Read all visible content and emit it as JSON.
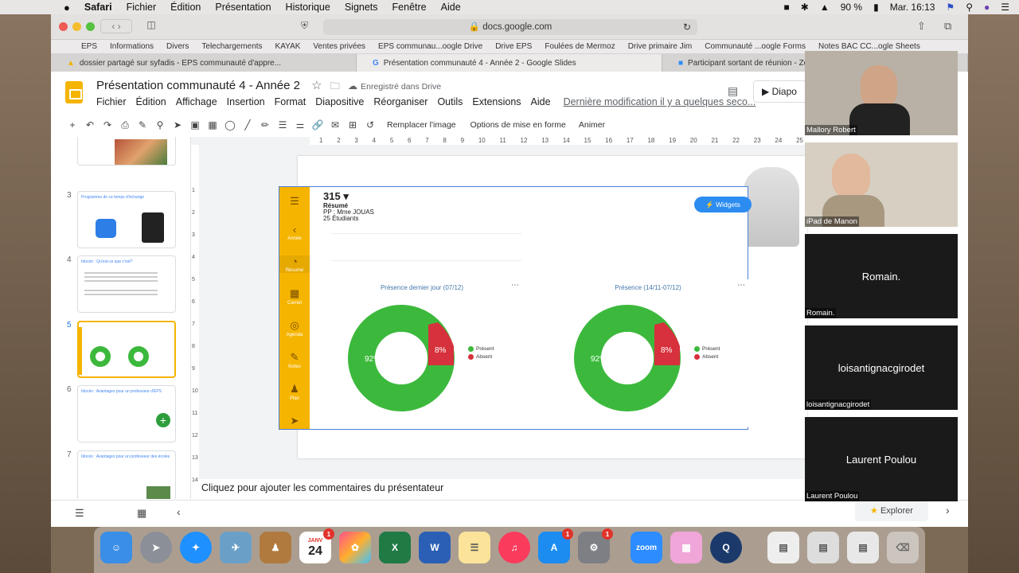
{
  "menubar": {
    "apple": "",
    "items": [
      "Safari",
      "Fichier",
      "Édition",
      "Présentation",
      "Historique",
      "Signets",
      "Fenêtre",
      "Aide"
    ],
    "battery": "90 %",
    "clock": "Mar. 16:13"
  },
  "browser": {
    "url": "docs.google.com",
    "bookmarks": [
      "EPS",
      "Informations",
      "Divers",
      "Telechargements",
      "KAYAK",
      "Ventes privées",
      "EPS communau...oogle Drive",
      "Drive EPS",
      "Foulées de Mermoz",
      "Drive primaire Jim",
      "Communauté ...oogle Forms",
      "Notes BAC CC...ogle Sheets"
    ],
    "tabs": [
      {
        "label": "dossier partagé sur syfadis - EPS communauté d'appre..."
      },
      {
        "label": "Présentation communauté 4 - Année 2 - Google Slides"
      },
      {
        "label": "Participant sortant de réunion - Zoom"
      }
    ]
  },
  "slides": {
    "title": "Présentation communauté 4 - Année 2",
    "saved": "Enregistré dans Drive",
    "menu": [
      "Fichier",
      "Édition",
      "Affichage",
      "Insertion",
      "Format",
      "Diapositive",
      "Réorganiser",
      "Outils",
      "Extensions",
      "Aide"
    ],
    "last_modified": "Dernière modification il y a quelques seco...",
    "present": "Diapo",
    "toolbar": {
      "replace_image": "Remplacer l'image",
      "format_options": "Options de mise en forme",
      "animate": "Animer"
    },
    "ruler": [
      "1",
      "2",
      "3",
      "4",
      "5",
      "6",
      "7",
      "8",
      "9",
      "10",
      "11",
      "12",
      "13",
      "14",
      "15",
      "16",
      "17",
      "18",
      "19",
      "20",
      "21",
      "22",
      "23",
      "24",
      "25"
    ],
    "vruler": [
      "1",
      "2",
      "3",
      "4",
      "5",
      "6",
      "7",
      "8",
      "9",
      "10",
      "11",
      "12",
      "13",
      "14"
    ],
    "notes_placeholder": "Cliquez pour ajouter les commentaires du présentateur",
    "explore": "Explorer",
    "thumbnails": [
      {
        "num": "3",
        "text": "Programme de ce temps d'échange"
      },
      {
        "num": "4",
        "text": "Idocéo : Qu'est-ce que c'est?"
      },
      {
        "num": "5",
        "text": ""
      },
      {
        "num": "6",
        "text": "Idocéo : Avantages pour un professeur d'EPS"
      },
      {
        "num": "7",
        "text": "Idocéo : Avantages pour un professeur des écoles"
      }
    ]
  },
  "app_screenshot": {
    "count": "315",
    "resume_title": "Résumé",
    "teacher": "PP : Mme JOUAS",
    "students": "25 Étudiants",
    "widgets_button": "Widgets",
    "sidebar": [
      "Année",
      "Résumé",
      "Carnet",
      "Agenda",
      "Notes",
      "Plan",
      ""
    ],
    "cards": [
      {
        "title": "Présence dernier jour (07/12)",
        "present_pct": "92%",
        "absent_pct": "8%",
        "legend_present": "Présent",
        "legend_absent": "Absent"
      },
      {
        "title": "Présence (14/11-07/12)",
        "present_pct": "92%",
        "absent_pct": "8%",
        "legend_present": "Présent",
        "legend_absent": "Absent"
      }
    ],
    "colors": {
      "present": "#3cb93c",
      "absent": "#d6313c",
      "sidebar": "#f5b400"
    }
  },
  "zoom": {
    "participants": [
      {
        "name": "Mallory Robert",
        "video": true
      },
      {
        "name": "iPad de Manon",
        "video": true
      },
      {
        "name": "Romain.",
        "label": "Romain.",
        "video": false
      },
      {
        "name": "loisantignacgirodet",
        "label": "loisantignacgirodet",
        "video": false
      },
      {
        "name": "Laurent Poulou",
        "label": "Laurent Poulou",
        "video": false
      }
    ]
  },
  "dock": {
    "calendar_month": "JANV",
    "calendar_day": "24",
    "badges": {
      "calendar": "1",
      "appstore": "1",
      "settings": "1"
    },
    "zoom_label": "zoom"
  }
}
